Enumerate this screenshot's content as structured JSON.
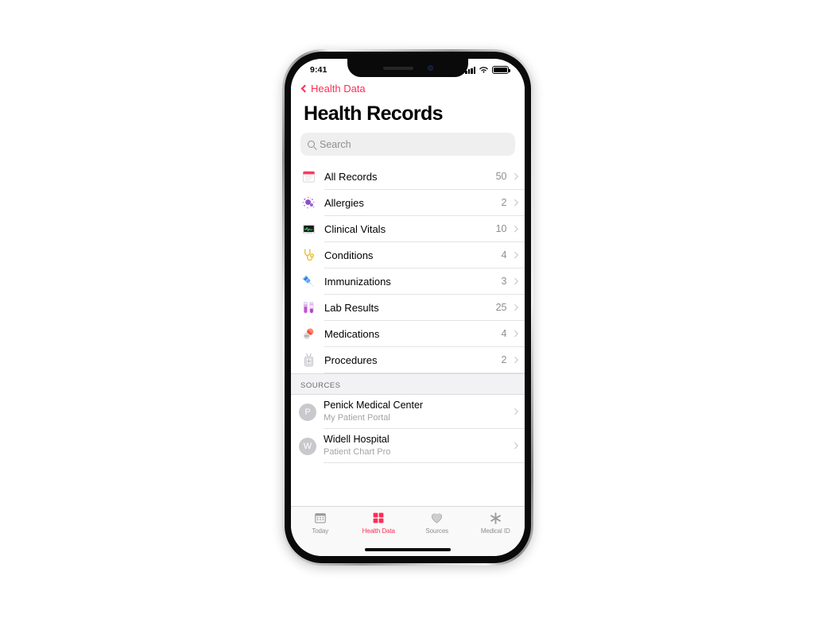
{
  "status_bar": {
    "time": "9:41",
    "cellular_icon": "signal-bars-icon",
    "wifi_icon": "wifi-icon",
    "battery_icon": "battery-full-icon"
  },
  "nav": {
    "back_label": "Health Data",
    "back_icon": "chevron-left-icon",
    "title": "Health Records"
  },
  "search": {
    "placeholder": "Search",
    "value": "",
    "icon": "search-icon"
  },
  "categories": [
    {
      "label": "All Records",
      "count": "50",
      "icon": "records-document-icon"
    },
    {
      "label": "Allergies",
      "count": "2",
      "icon": "allergen-pollen-icon"
    },
    {
      "label": "Clinical Vitals",
      "count": "10",
      "icon": "vitals-monitor-icon"
    },
    {
      "label": "Conditions",
      "count": "4",
      "icon": "stethoscope-icon"
    },
    {
      "label": "Immunizations",
      "count": "3",
      "icon": "syringe-icon"
    },
    {
      "label": "Lab Results",
      "count": "25",
      "icon": "test-tubes-icon"
    },
    {
      "label": "Medications",
      "count": "4",
      "icon": "pills-icon"
    },
    {
      "label": "Procedures",
      "count": "2",
      "icon": "surgery-tools-icon"
    }
  ],
  "sources": {
    "header": "SOURCES",
    "items": [
      {
        "initial": "P",
        "title": "Penick Medical Center",
        "subtitle": "My Patient Portal"
      },
      {
        "initial": "W",
        "title": "Widell Hospital",
        "subtitle": "Patient Chart Pro"
      }
    ]
  },
  "tabs": [
    {
      "label": "Today",
      "icon": "calendar-icon",
      "active": false
    },
    {
      "label": "Health Data",
      "icon": "health-squares-icon",
      "active": true
    },
    {
      "label": "Sources",
      "icon": "heart-icon",
      "active": false
    },
    {
      "label": "Medical ID",
      "icon": "asterisk-icon",
      "active": false
    }
  ],
  "colors": {
    "accent_pink": "#FF2D55",
    "secondary_gray": "#8e8e93",
    "separator": "#e3e3e5",
    "section_bg": "#f2f2f4"
  }
}
